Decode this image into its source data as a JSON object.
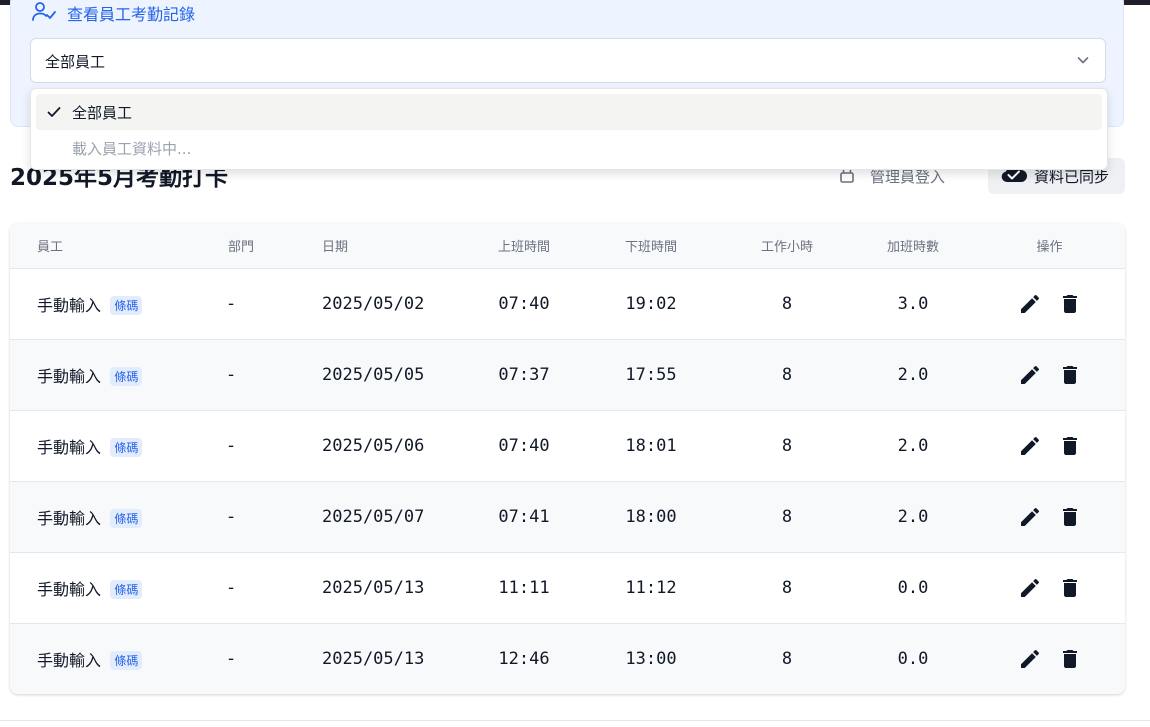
{
  "filter": {
    "title": "查看員工考勤記錄",
    "selected_value": "全部員工",
    "options": [
      {
        "label": "全部員工",
        "selected": true
      },
      {
        "label": "載入員工資料中...",
        "selected": false
      }
    ]
  },
  "section": {
    "title": "2025年5月考勤打卡",
    "admin_login_label": "管理員登入",
    "sync_label": "資料已同步"
  },
  "table": {
    "headers": {
      "employee": "員工",
      "department": "部門",
      "date": "日期",
      "clock_in": "上班時間",
      "clock_out": "下班時間",
      "work_hours": "工作小時",
      "overtime": "加班時數",
      "actions": "操作"
    },
    "rows": [
      {
        "name": "手動輸入",
        "tag": "條碼",
        "department": "-",
        "date": "2025/05/02",
        "in": "07:40",
        "out": "19:02",
        "hours": "8",
        "overtime": "3.0"
      },
      {
        "name": "手動輸入",
        "tag": "條碼",
        "department": "-",
        "date": "2025/05/05",
        "in": "07:37",
        "out": "17:55",
        "hours": "8",
        "overtime": "2.0"
      },
      {
        "name": "手動輸入",
        "tag": "條碼",
        "department": "-",
        "date": "2025/05/06",
        "in": "07:40",
        "out": "18:01",
        "hours": "8",
        "overtime": "2.0"
      },
      {
        "name": "手動輸入",
        "tag": "條碼",
        "department": "-",
        "date": "2025/05/07",
        "in": "07:41",
        "out": "18:00",
        "hours": "8",
        "overtime": "2.0"
      },
      {
        "name": "手動輸入",
        "tag": "條碼",
        "department": "-",
        "date": "2025/05/13",
        "in": "11:11",
        "out": "11:12",
        "hours": "8",
        "overtime": "0.0"
      },
      {
        "name": "手動輸入",
        "tag": "條碼",
        "department": "-",
        "date": "2025/05/13",
        "in": "12:46",
        "out": "13:00",
        "hours": "8",
        "overtime": "0.0"
      }
    ]
  },
  "icons": {
    "panel_header": "users-check-icon",
    "select": "chevron-down-icon",
    "selected_option": "check-icon",
    "admin_login": "lock-icon",
    "sync": "cloud-check-icon",
    "edit": "pencil-icon",
    "delete": "trash-icon"
  },
  "colors": {
    "accent": "#2563eb",
    "panel_bg": "#eef4ff",
    "row_alt": "#f8f9fb",
    "tag_bg": "#e3ecfd"
  }
}
